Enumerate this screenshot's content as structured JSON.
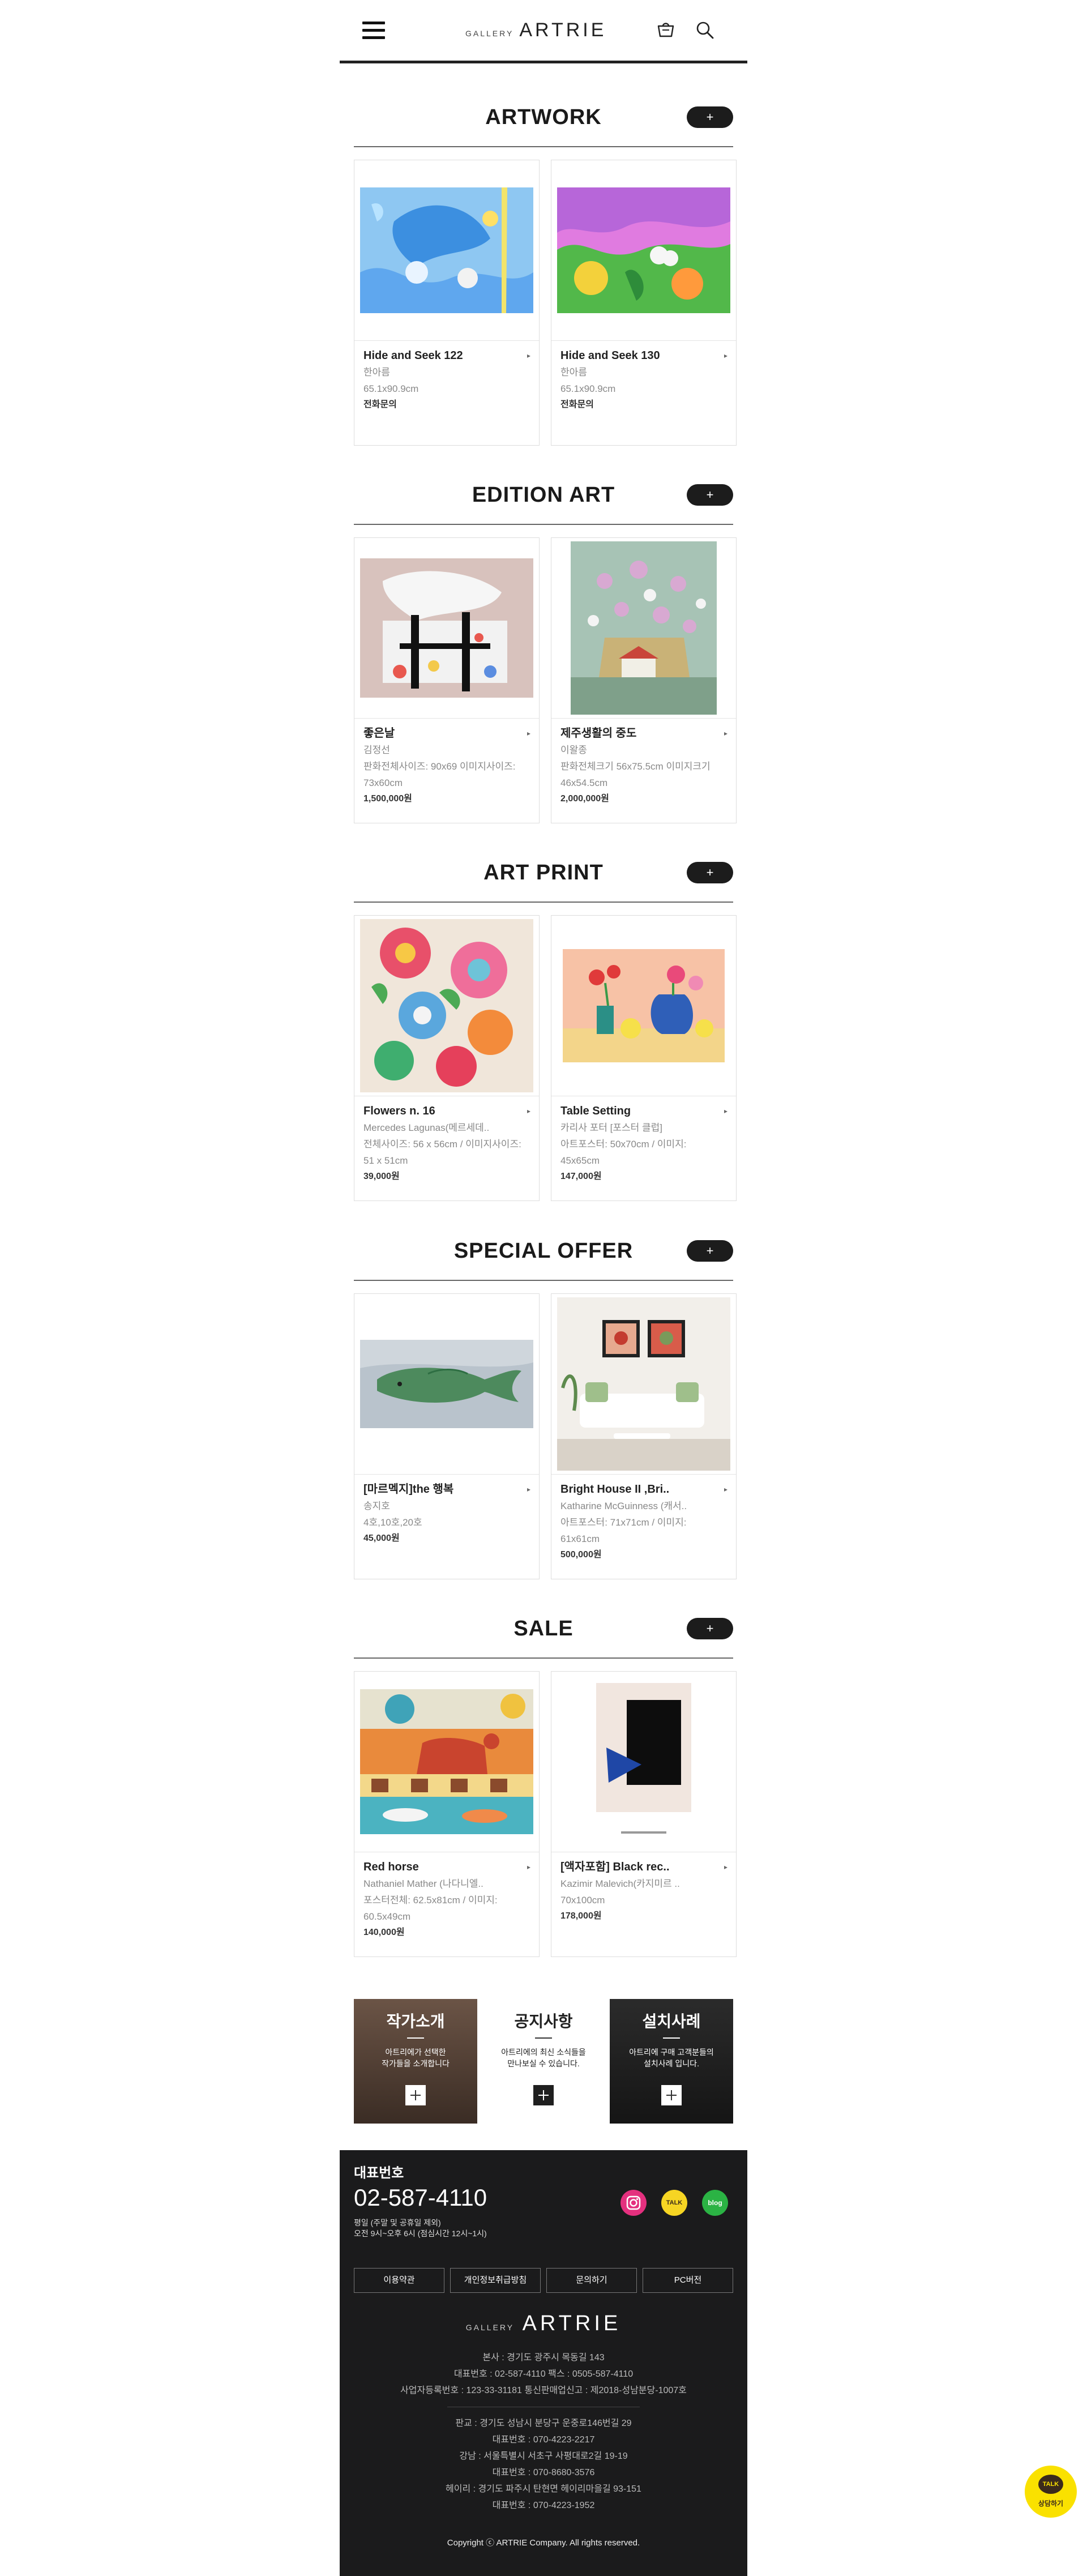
{
  "header": {
    "logo_small": "GALLERY",
    "logo_big": "ARTRIE"
  },
  "sections": [
    {
      "title": "ARTWORK",
      "more": "+",
      "items": [
        {
          "name": "Hide and Seek 122",
          "artist": "한아름",
          "detail": "65.1x90.9cm",
          "price": "전화문의"
        },
        {
          "name": "Hide and Seek 130",
          "artist": "한아름",
          "detail": "65.1x90.9cm",
          "price": "전화문의"
        }
      ]
    },
    {
      "title": "EDITION ART",
      "more": "+",
      "items": [
        {
          "name": "좋은날",
          "artist": "김정선",
          "detail": "판화전체사이즈: 90x69 이미지사이즈: 73x60cm",
          "price": "1,500,000원"
        },
        {
          "name": "제주생활의 중도",
          "artist": "이왈종",
          "detail": "판화전체크기 56x75.5cm 이미지크기 46x54.5cm",
          "price": "2,000,000원"
        }
      ]
    },
    {
      "title": "ART PRINT",
      "more": "+",
      "items": [
        {
          "name": "Flowers n. 16",
          "artist": "Mercedes Lagunas(메르세데..",
          "detail": "전체사이즈: 56 x 56cm / 이미지사이즈: 51 x 51cm",
          "price": "39,000원"
        },
        {
          "name": "Table Setting",
          "artist": "카리사 포터 [포스터 클럽]",
          "detail": "아트포스터: 50x70cm / 이미지: 45x65cm",
          "price": "147,000원"
        }
      ]
    },
    {
      "title": "SPECIAL OFFER",
      "more": "+",
      "items": [
        {
          "name": "[마르멕지]the 행복",
          "artist": "송지호",
          "detail": "4호,10호,20호",
          "price": "45,000원"
        },
        {
          "name": "Bright House II ,Bri..",
          "artist": "Katharine McGuinness (캐서..",
          "detail": "아트포스터: 71x71cm / 이미지: 61x61cm",
          "price": "500,000원"
        }
      ]
    },
    {
      "title": "SALE",
      "more": "+",
      "items": [
        {
          "name": "Red horse",
          "artist": "Nathaniel Mather (나다니엘..",
          "detail": "포스터전체: 62.5x81cm / 이미지: 60.5x49cm",
          "price": "140,000원"
        },
        {
          "name": "[액자포함] Black rec..",
          "artist": "Kazimir Malevich(카지미르 ..",
          "detail": "70x100cm",
          "price": "178,000원"
        }
      ]
    }
  ],
  "promo": [
    {
      "title": "작가소개",
      "text1": "아트리에가 선택한",
      "text2": "작가들을 소개합니다"
    },
    {
      "title": "공지사항",
      "text1": "아트리에의 최신 소식들을",
      "text2": "만나보실 수 있습니다."
    },
    {
      "title": "설치사례",
      "text1": "아트리에 구매 고객분들의",
      "text2": "설치사례 입니다."
    }
  ],
  "footer": {
    "phone_label": "대표번호",
    "phone": "02-587-4110",
    "hours1": "평일 (주말 및 공휴일 제외)",
    "hours2": "오전 9시~오후 6시 (점심시간 12시~1시)",
    "social": [
      "instagram",
      "kakaotalk",
      "blog"
    ],
    "kakao_badge": "TALK",
    "blog_badge": "blog",
    "links": [
      "이용약관",
      "개인정보취급방침",
      "문의하기",
      "PC버전"
    ],
    "logo_small": "GALLERY",
    "logo_big": "ARTRIE",
    "addr_lines": [
      "본사 : 경기도 광주시 목동길 143",
      "대표번호 : 02-587-4110  팩스 : 0505-587-4110",
      "사업자등록번호 : 123-33-31181  통신판매업신고 : 제2018-성남분당-1007호"
    ],
    "branch_lines": [
      "판교 : 경기도 성남시 분당구 운중로146번길 29",
      "대표번호 : 070-4223-2217",
      "강남 : 서울특별시 서초구 사평대로2길 19-19",
      "대표번호 : 070-8680-3576",
      "헤이리 : 경기도 파주시 탄현면 헤이리마을길 93-151",
      "대표번호 : 070-4223-1952"
    ],
    "copyright": "Copyright ⓒ ARTRIE Company. All rights reserved."
  },
  "kakao_float": {
    "badge": "TALK",
    "label": "상담하기"
  }
}
